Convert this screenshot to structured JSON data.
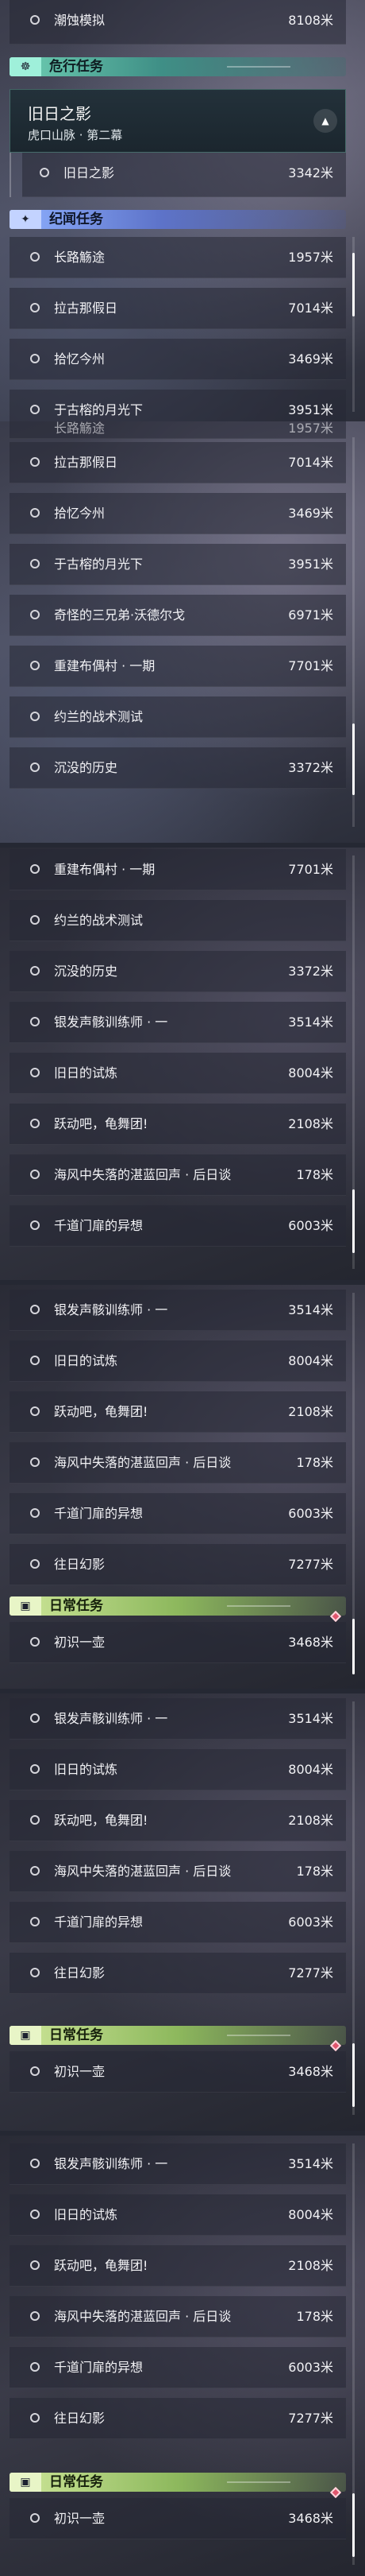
{
  "sections": {
    "danger_title": "危行任务",
    "story_title": "纪闻任务",
    "daily_title": "日常任务"
  },
  "top_item": {
    "label": "潮蚀模拟",
    "dist": "8108米"
  },
  "expanded": {
    "title": "旧日之影",
    "subtitle": "虎口山脉 · 第二幕",
    "toggle_icon": "chevron-up-icon"
  },
  "danger_sub": {
    "label": "旧日之影",
    "dist": "3342米"
  },
  "story_items": [
    {
      "label": "长路觞途",
      "dist": "1957米"
    },
    {
      "label": "拉古那假日",
      "dist": "7014米"
    },
    {
      "label": "拾忆今州",
      "dist": "3469米"
    },
    {
      "label": "于古榕的月光下",
      "dist": "3951米"
    },
    {
      "label": "奇怪的三兄弟·沃德尔戈",
      "dist": "6971米"
    },
    {
      "label": "重建布偶村 · 一期",
      "dist": "7701米"
    },
    {
      "label": "约兰的战术测试",
      "dist": ""
    },
    {
      "label": "沉没的历史",
      "dist": "3372米"
    },
    {
      "label": "银发声骸训练师 · 一",
      "dist": "3514米"
    },
    {
      "label": "旧日的试炼",
      "dist": "8004米"
    },
    {
      "label": "跃动吧，龟舞团!",
      "dist": "2108米"
    },
    {
      "label": "海风中失落的湛蓝回声 · 后日谈",
      "dist": "178米"
    },
    {
      "label": "千道门扉的异想",
      "dist": "6003米"
    },
    {
      "label": "往日幻影",
      "dist": "7277米"
    }
  ],
  "daily_items": [
    {
      "label": "初识一壶",
      "dist": "3468米"
    }
  ],
  "header_lines": "",
  "colors": {
    "danger": "#6fd0b4",
    "story": "#8fb1ff",
    "daily": "#cfe79a",
    "alert": "#e0566d"
  }
}
